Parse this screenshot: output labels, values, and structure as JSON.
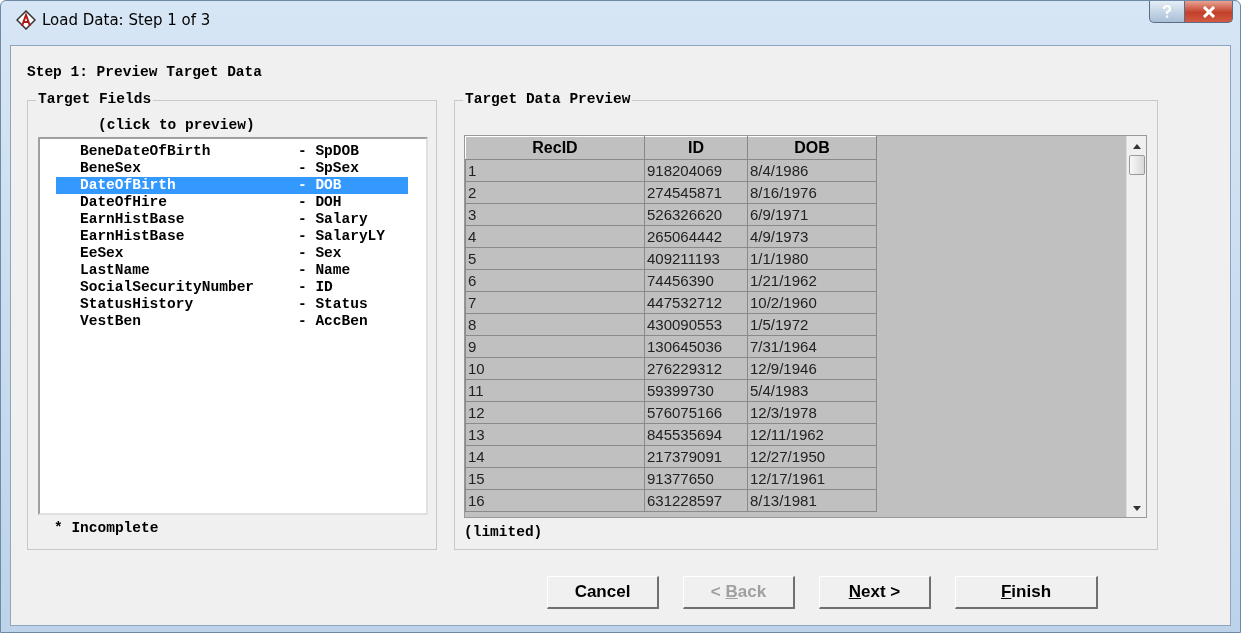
{
  "window": {
    "title": "Load Data: Step 1 of 3"
  },
  "step_title": "Step 1: Preview Target Data",
  "target_fields": {
    "legend": "Target Fields",
    "hint": "(click to preview)",
    "items": [
      {
        "field": "BeneDateOfBirth",
        "target": "- SpDOB",
        "selected": false
      },
      {
        "field": "BeneSex",
        "target": "- SpSex",
        "selected": false
      },
      {
        "field": "DateOfBirth",
        "target": "- DOB",
        "selected": true
      },
      {
        "field": "DateOfHire",
        "target": "- DOH",
        "selected": false
      },
      {
        "field": "EarnHistBase",
        "target": "- Salary",
        "selected": false
      },
      {
        "field": "EarnHistBase",
        "target": "- SalaryLY",
        "selected": false
      },
      {
        "field": "EeSex",
        "target": "- Sex",
        "selected": false
      },
      {
        "field": "LastName",
        "target": "- Name",
        "selected": false
      },
      {
        "field": "SocialSecurityNumber",
        "target": "- ID",
        "selected": false
      },
      {
        "field": "StatusHistory",
        "target": "- Status",
        "selected": false
      },
      {
        "field": "VestBen",
        "target": "- AccBen",
        "selected": false
      }
    ],
    "footnote": "* Incomplete"
  },
  "preview": {
    "legend": "Target Data Preview",
    "columns": [
      "RecID",
      "ID",
      "DOB"
    ],
    "rows": [
      [
        "1",
        "918204069",
        "8/4/1986"
      ],
      [
        "2",
        "274545871",
        "8/16/1976"
      ],
      [
        "3",
        "526326620",
        "6/9/1971"
      ],
      [
        "4",
        "265064442",
        "4/9/1973"
      ],
      [
        "5",
        "409211193",
        "1/1/1980"
      ],
      [
        "6",
        "74456390",
        "1/21/1962"
      ],
      [
        "7",
        "447532712",
        "10/2/1960"
      ],
      [
        "8",
        "430090553",
        "1/5/1972"
      ],
      [
        "9",
        "130645036",
        "7/31/1964"
      ],
      [
        "10",
        "276229312",
        "12/9/1946"
      ],
      [
        "11",
        "59399730",
        "5/4/1983"
      ],
      [
        "12",
        "576075166",
        "12/3/1978"
      ],
      [
        "13",
        "845535694",
        "12/11/1962"
      ],
      [
        "14",
        "217379091",
        "12/27/1950"
      ],
      [
        "15",
        "91377650",
        "12/17/1961"
      ],
      [
        "16",
        "631228597",
        "8/13/1981"
      ]
    ],
    "note": "(limited)"
  },
  "buttons": [
    {
      "label_start": "Cancel",
      "disabled": false
    },
    {
      "label_start": "< ",
      "access_key": "B",
      "label_end": "ack",
      "disabled": true
    },
    {
      "access_key": "N",
      "label_end": "ext >",
      "disabled": false
    },
    {
      "access_key": "F",
      "label_end": "inish",
      "disabled": false
    }
  ]
}
